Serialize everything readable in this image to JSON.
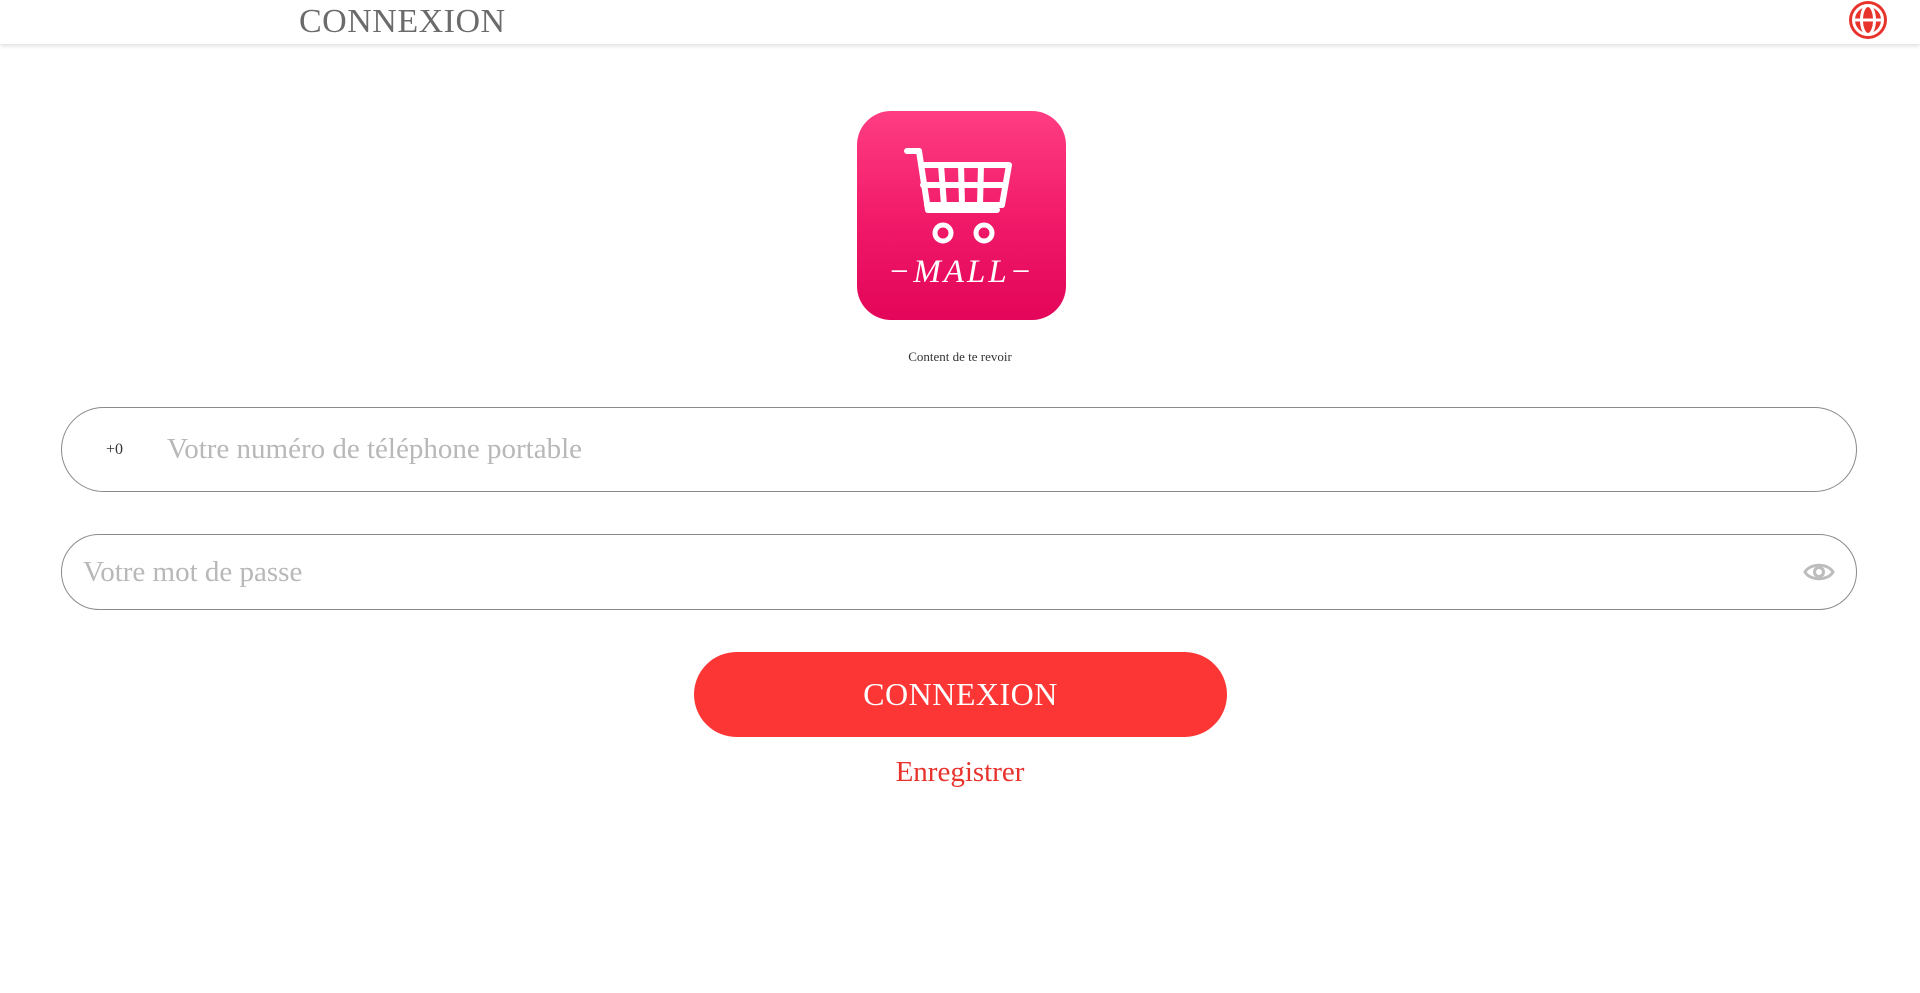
{
  "header": {
    "title": "CONNEXION",
    "language_icon": "globe-icon"
  },
  "logo": {
    "icon": "shopping-cart-icon",
    "text": "−MALL−"
  },
  "welcome_text": "Content de te revoir",
  "phone_field": {
    "prefix": "+0",
    "value": "",
    "placeholder": "Votre numéro de téléphone portable"
  },
  "password_field": {
    "value": "",
    "placeholder": "Votre mot de passe",
    "toggle_icon": "eye-icon"
  },
  "login_button": {
    "label": "CONNEXION"
  },
  "register_link": {
    "label": "Enregistrer"
  },
  "colors": {
    "accent": "#fc3535",
    "logo_gradient_top": "#ff3d82",
    "logo_gradient_bottom": "#e30559",
    "header_text": "#6b6b6b",
    "placeholder": "#b8b8b8"
  }
}
